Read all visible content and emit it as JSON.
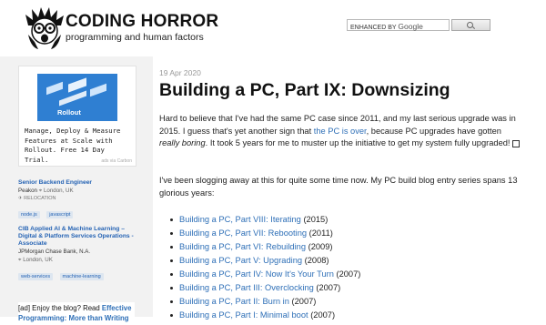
{
  "header": {
    "site_title": "CODING HORROR",
    "tagline": "programming and human factors",
    "search": {
      "brand_prefix": "ENHANCED BY",
      "brand": "Google"
    }
  },
  "sidebar": {
    "ad": {
      "image_brand": "Rollout",
      "text": "Manage, Deploy & Measure Features at Scale with Rollout. Free 14 Day Trial.",
      "via": "ads via Carbon"
    },
    "jobs": [
      {
        "title": "Senior Backend Engineer",
        "company": "Peakon",
        "location": "London, UK",
        "meta": "RELOCATION",
        "tags": [
          "node.js",
          "javascript"
        ]
      },
      {
        "title": "CIB Applied AI & Machine Learning – Digital & Platform Services Operations - Associate",
        "company": "JPMorgan Chase Bank, N.A.",
        "location": "London, UK",
        "meta": "",
        "tags": [
          "web-services",
          "machine-learning"
        ]
      }
    ],
    "promo": {
      "text": "[ad] Enjoy the blog? Read ",
      "link": "Effective Programming: More than Writing"
    }
  },
  "post": {
    "date": "19 Apr 2020",
    "title": "Building a PC, Part IX: Downsizing",
    "p1": {
      "a": "Hard to believe that I've had the same PC case since 2011, and my last serious upgrade was in 2015. I guess that's yet another sign that ",
      "link": "the PC is over",
      "b": ", because PC upgrades have gotten ",
      "em": "really boring",
      "c": ". It took 5 years for me to muster up the initiative to get my system fully upgraded! "
    },
    "p2": "I've been slogging away at this for quite some time now. My PC build blog entry series spans 13 glorious years:",
    "series": [
      {
        "title": "Building a PC, Part VIII: Iterating",
        "year": "(2015)"
      },
      {
        "title": "Building a PC, Part VII: Rebooting",
        "year": "(2011)"
      },
      {
        "title": "Building a PC, Part VI: Rebuilding",
        "year": "(2009)"
      },
      {
        "title": "Building a PC, Part V: Upgrading",
        "year": "(2008)"
      },
      {
        "title": "Building a PC, Part IV: Now It's Your Turn",
        "year": "(2007)"
      },
      {
        "title": "Building a PC, Part III: Overclocking",
        "year": "(2007)"
      },
      {
        "title": "Building a PC, Part II: Burn in",
        "year": "(2007)"
      },
      {
        "title": "Building a PC, Part I: Minimal boot",
        "year": "(2007)"
      }
    ]
  }
}
